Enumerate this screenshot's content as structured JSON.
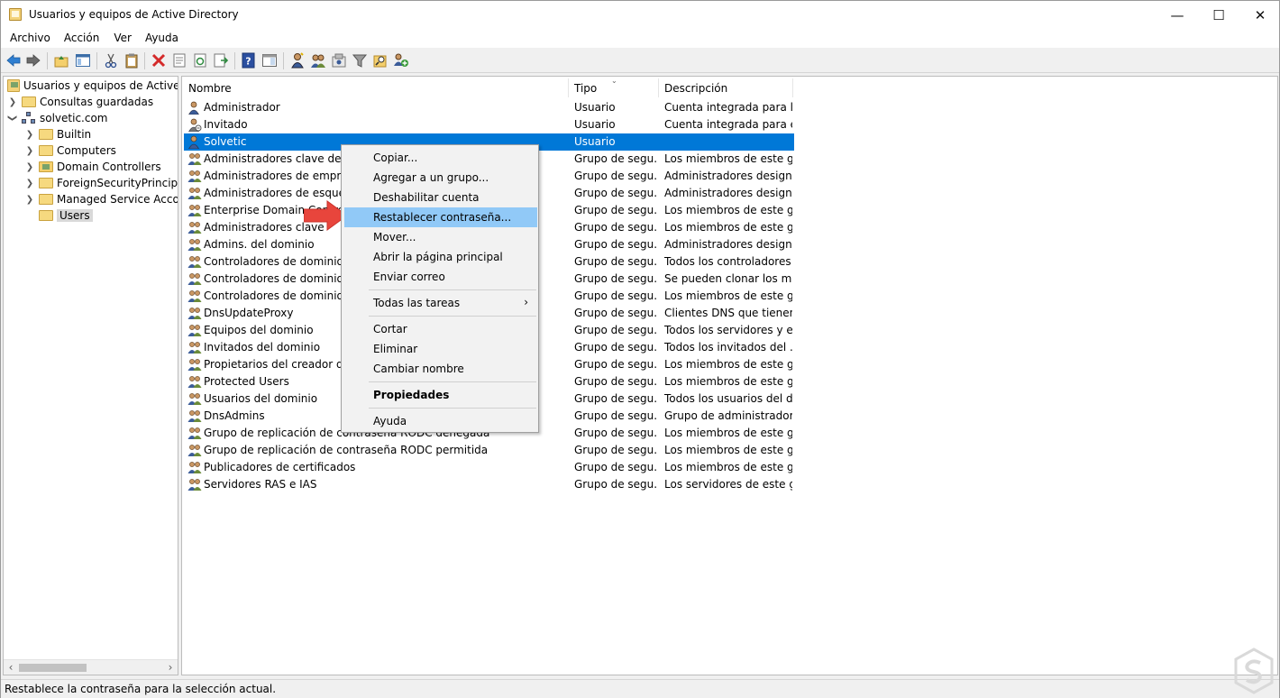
{
  "window": {
    "title": "Usuarios y equipos de Active Directory",
    "minimize": "—",
    "maximize": "☐",
    "close": "✕"
  },
  "menubar": [
    "Archivo",
    "Acción",
    "Ver",
    "Ayuda"
  ],
  "tree": {
    "root": "Usuarios y equipos de Active Directory",
    "saved_queries": "Consultas guardadas",
    "domain": "solvetic.com",
    "children": [
      "Builtin",
      "Computers",
      "Domain Controllers",
      "ForeignSecurityPrincipals",
      "Managed Service Accounts",
      "Users"
    ]
  },
  "columns": [
    "Nombre",
    "Tipo",
    "Descripción"
  ],
  "rows": [
    {
      "name": "Administrador",
      "type": "Usuario",
      "desc": "Cuenta integrada para la..."
    },
    {
      "name": "Invitado",
      "type": "Usuario",
      "desc": "Cuenta integrada para el..."
    },
    {
      "name": "Solvetic",
      "type": "Usuario",
      "desc": ""
    },
    {
      "name": "Administradores clave de la organización",
      "type": "Grupo de segu...",
      "desc": "Los miembros de este gr..."
    },
    {
      "name": "Administradores de empresas",
      "type": "Grupo de segu...",
      "desc": "Administradores design..."
    },
    {
      "name": "Administradores de esquema",
      "type": "Grupo de segu...",
      "desc": "Administradores design..."
    },
    {
      "name": "Enterprise Domain Controllers de solo lectura",
      "type": "Grupo de segu...",
      "desc": "Los miembros de este gr..."
    },
    {
      "name": "Administradores clave",
      "type": "Grupo de segu...",
      "desc": "Los miembros de este gr..."
    },
    {
      "name": "Admins. del dominio",
      "type": "Grupo de segu...",
      "desc": "Administradores design..."
    },
    {
      "name": "Controladores de dominio",
      "type": "Grupo de segu...",
      "desc": "Todos los controladores ..."
    },
    {
      "name": "Controladores de dominio clonables",
      "type": "Grupo de segu...",
      "desc": "Se pueden clonar los mi..."
    },
    {
      "name": "Controladores de dominio de solo lectura",
      "type": "Grupo de segu...",
      "desc": "Los miembros de este gr..."
    },
    {
      "name": "DnsUpdateProxy",
      "type": "Grupo de segu...",
      "desc": "Clientes DNS que tienen..."
    },
    {
      "name": "Equipos del dominio",
      "type": "Grupo de segu...",
      "desc": "Todos los servidores y es..."
    },
    {
      "name": "Invitados del dominio",
      "type": "Grupo de segu...",
      "desc": "Todos los invitados del ..."
    },
    {
      "name": "Propietarios del creador de directivas de grupo",
      "type": "Grupo de segu...",
      "desc": "Los miembros de este gr..."
    },
    {
      "name": "Protected Users",
      "type": "Grupo de segu...",
      "desc": "Los miembros de este gr..."
    },
    {
      "name": "Usuarios del dominio",
      "type": "Grupo de segu...",
      "desc": "Todos los usuarios del d..."
    },
    {
      "name": "DnsAdmins",
      "type": "Grupo de segu...",
      "desc": "Grupo de administrador..."
    },
    {
      "name": "Grupo de replicación de contraseña RODC denegada",
      "type": "Grupo de segu...",
      "desc": "Los miembros de este gr..."
    },
    {
      "name": "Grupo de replicación de contraseña RODC permitida",
      "type": "Grupo de segu...",
      "desc": "Los miembros de este gr..."
    },
    {
      "name": "Publicadores de certificados",
      "type": "Grupo de segu...",
      "desc": "Los miembros de este gr..."
    },
    {
      "name": "Servidores RAS e IAS",
      "type": "Grupo de segu...",
      "desc": "Los servidores de este gr..."
    }
  ],
  "context_menu": {
    "copy": "Copiar...",
    "add_to_group": "Agregar a un grupo...",
    "disable": "Deshabilitar cuenta",
    "reset_password": "Restablecer contraseña...",
    "move": "Mover...",
    "open_home": "Abrir la página principal",
    "send_mail": "Enviar correo",
    "all_tasks": "Todas las tareas",
    "cut": "Cortar",
    "delete": "Eliminar",
    "rename": "Cambiar nombre",
    "properties": "Propiedades",
    "help": "Ayuda",
    "submenu_arrow": "›"
  },
  "status": "Restablece la contraseña para la selección actual.",
  "colors": {
    "selection": "#0078d7",
    "menu_highlight": "#91c9f7",
    "arrow": "#e8453c"
  }
}
